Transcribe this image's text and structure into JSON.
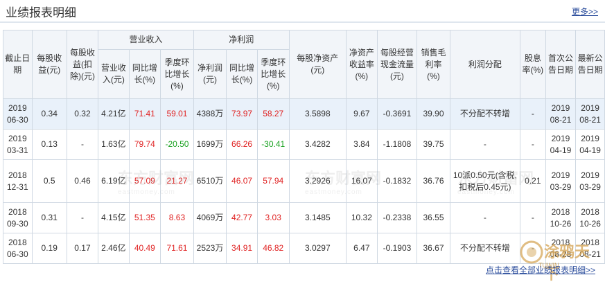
{
  "header": {
    "title": "业绩报表明细",
    "more_link": "更多>>"
  },
  "table": {
    "headers": {
      "report_date": "截止日期",
      "eps_basic": "每股收益(元)",
      "eps_diluted": "每股收益(扣除)(元)",
      "revenue_group": "营业收入",
      "net_profit_group": "净利润",
      "revenue": "营业收入(元)",
      "revenue_yoy": "同比增长(%)",
      "revenue_qoq": "季度环比增长(%)",
      "net_profit": "净利润(元)",
      "net_profit_yoy": "同比增长(%)",
      "net_profit_qoq": "季度环比增长(%)",
      "bvps": "每股净资产(元)",
      "roe": "净资产收益率(%)",
      "ocfps": "每股经营现金流量(元)",
      "gross_margin": "销售毛利率(%)",
      "distribution": "利润分配",
      "dividend_yield": "股息率(%)",
      "first_announce": "首次公告日期",
      "latest_announce": "最新公告日期"
    },
    "rows": [
      {
        "date": "2019 06-30",
        "eps": "0.34",
        "eps_d": "0.32",
        "rev": "4.21亿",
        "rev_yoy": "71.41",
        "rev_qoq": "59.01",
        "np": "4388万",
        "np_yoy": "73.97",
        "np_qoq": "58.27",
        "bvps": "3.5898",
        "roe": "9.67",
        "ocf": "-0.3691",
        "gm": "39.90",
        "dist": "不分配不转增",
        "dy": "-",
        "first": "2019 08-21",
        "latest": "2019 08-21"
      },
      {
        "date": "2019 03-31",
        "eps": "0.13",
        "eps_d": "-",
        "rev": "1.63亿",
        "rev_yoy": "79.74",
        "rev_qoq": "-20.50",
        "np": "1699万",
        "np_yoy": "66.26",
        "np_qoq": "-30.41",
        "bvps": "3.4282",
        "roe": "3.84",
        "ocf": "-1.1808",
        "gm": "39.75",
        "dist": "-",
        "dy": "-",
        "first": "2019 04-19",
        "latest": "2019 04-19"
      },
      {
        "date": "2018 12-31",
        "eps": "0.5",
        "eps_d": "0.46",
        "rev": "6.19亿",
        "rev_yoy": "57.09",
        "rev_qoq": "21.27",
        "np": "6510万",
        "np_yoy": "46.07",
        "np_qoq": "57.94",
        "bvps": "3.2926",
        "roe": "16.07",
        "ocf": "-0.1832",
        "gm": "36.76",
        "dist": "10派0.50元(含税,扣税后0.45元)",
        "dy": "0.21",
        "first": "2019 03-29",
        "latest": "2019 03-29"
      },
      {
        "date": "2018 09-30",
        "eps": "0.31",
        "eps_d": "-",
        "rev": "4.15亿",
        "rev_yoy": "51.35",
        "rev_qoq": "8.63",
        "np": "4069万",
        "np_yoy": "42.77",
        "np_qoq": "3.03",
        "bvps": "3.1485",
        "roe": "10.32",
        "ocf": "-0.2338",
        "gm": "36.55",
        "dist": "-",
        "dy": "-",
        "first": "2018 10-26",
        "latest": "2018 10-26"
      },
      {
        "date": "2018 06-30",
        "eps": "0.19",
        "eps_d": "0.17",
        "rev": "2.46亿",
        "rev_yoy": "40.49",
        "rev_qoq": "71.61",
        "np": "2523万",
        "np_yoy": "34.91",
        "np_qoq": "46.82",
        "bvps": "3.0297",
        "roe": "6.47",
        "ocf": "-0.1903",
        "gm": "36.67",
        "dist": "不分配不转增",
        "dy": "-",
        "first": "2018 08-28",
        "latest": "2018 08-21"
      }
    ]
  },
  "footer": {
    "all_link": "点击查看全部业绩报表明细>>"
  },
  "watermark": {
    "text": "东方财富网",
    "sub": "eastmoney.com",
    "logo_text": "涂鸦天下",
    "logo_sub": "TUWIN"
  },
  "colors": {
    "positive": "#e02222",
    "negative": "#18a11f",
    "link": "#2b4d9c",
    "header_bg": "#f2f5f9",
    "stripe_bg": "#e9f1fa"
  }
}
